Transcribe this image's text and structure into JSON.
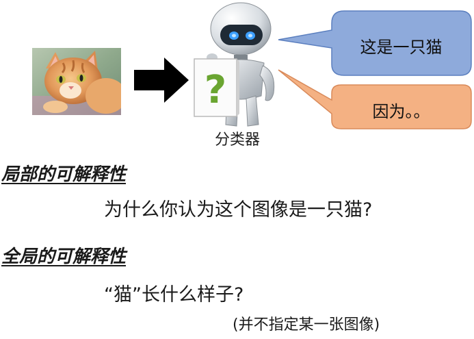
{
  "diagram": {
    "classifier_label": "分类器",
    "robot_sign_symbol": "?",
    "bubble_answer": "这是一只猫",
    "bubble_reason": "因为。。",
    "local_heading": "局部的可解释性",
    "local_question": "为什么你认为这个图像是一只猫?",
    "global_heading": "全局的可解释性",
    "global_question": "“猫”长什么样子?",
    "global_note": "(并不指定某一张图像)"
  },
  "colors": {
    "bubble_blue_fill": "#8eaadb",
    "bubble_orange_fill": "#f4b183",
    "sign_question_mark": "#6aa531"
  }
}
